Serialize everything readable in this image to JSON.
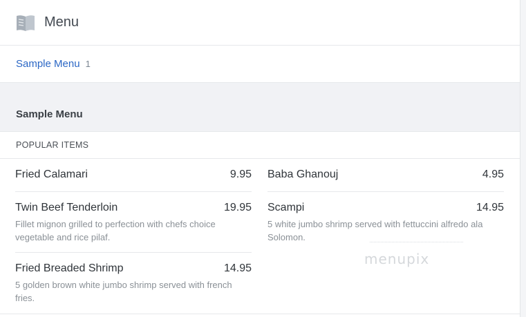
{
  "header": {
    "title": "Menu",
    "icon": "open-book-icon"
  },
  "tabs": [
    {
      "label": "Sample Menu",
      "count": "1"
    }
  ],
  "section": {
    "title": "Sample Menu",
    "category": "POPULAR ITEMS",
    "left_items": [
      {
        "name": "Fried Calamari",
        "price": "9.95",
        "description": ""
      },
      {
        "name": "Twin Beef Tenderloin",
        "price": "19.95",
        "description": "Fillet mignon grilled to perfection with chefs choice vegetable and rice pilaf."
      },
      {
        "name": "Fried Breaded Shrimp",
        "price": "14.95",
        "description": "5 golden brown white jumbo shrimp served with french fries."
      }
    ],
    "right_items": [
      {
        "name": "Baba Ghanouj",
        "price": "4.95",
        "description": ""
      },
      {
        "name": "Scampi",
        "price": "14.95",
        "description": "5 white jumbo shrimp served with fettuccini alfredo ala Solomon."
      }
    ]
  },
  "watermark": "menupix",
  "colors": {
    "link": "#2b67c5",
    "section_bg": "#f1f2f5",
    "icon": "#9aa3ad"
  }
}
